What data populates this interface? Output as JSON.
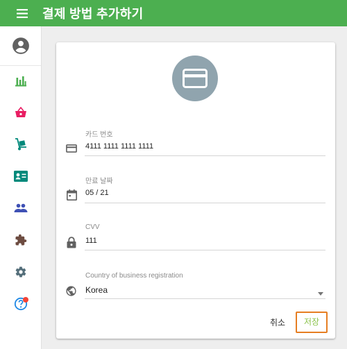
{
  "appbar": {
    "title": "결제 방법 추가하기",
    "menu_icon": "hamburger-menu-icon",
    "bg_color": "#4caf50"
  },
  "sidebar": {
    "items": [
      {
        "icon": "account-circle-icon",
        "color": "#616161"
      },
      {
        "icon": "bar-chart-icon",
        "color": "#4caf50"
      },
      {
        "icon": "shopping-basket-icon",
        "color": "#e91e63"
      },
      {
        "icon": "hand-truck-icon",
        "color": "#00897b"
      },
      {
        "icon": "contact-card-icon",
        "color": "#00897b"
      },
      {
        "icon": "people-icon",
        "color": "#3f51b5"
      },
      {
        "icon": "puzzle-piece-icon",
        "color": "#6d4c41"
      },
      {
        "icon": "settings-gear-icon",
        "color": "#546e7a"
      },
      {
        "icon": "help-circle-icon",
        "color": "#1e88e5",
        "badge_color": "#f44336"
      }
    ]
  },
  "form": {
    "header_icon": "credit-card-icon",
    "card_number": {
      "label": "카드 번호",
      "value": "4111 1111 1111 1111",
      "icon": "credit-card-icon"
    },
    "expiry": {
      "label": "만료 날짜",
      "value": "05 / 21",
      "icon": "calendar-icon"
    },
    "cvv": {
      "label": "CVV",
      "value": "111",
      "icon": "lock-icon"
    },
    "country": {
      "label": "Country of business registration",
      "value": "Korea",
      "icon": "globe-icon"
    },
    "cancel_label": "취소",
    "save_label": "저장"
  }
}
